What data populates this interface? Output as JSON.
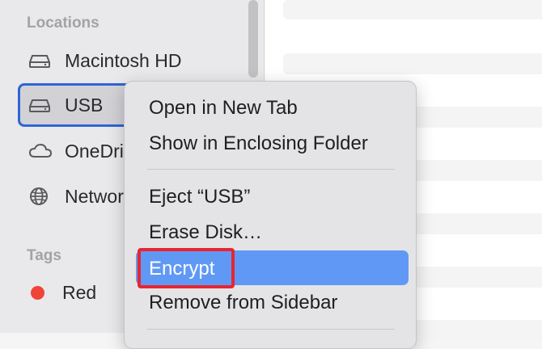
{
  "sidebar": {
    "locations_header": "Locations",
    "tags_header": "Tags",
    "items": [
      {
        "label": "Macintosh HD",
        "icon": "internal-drive-icon"
      },
      {
        "label": "USB",
        "icon": "external-drive-icon",
        "selected": true
      },
      {
        "label": "OneDrive",
        "icon": "cloud-icon"
      },
      {
        "label": "Network",
        "icon": "globe-icon"
      }
    ],
    "tags": [
      {
        "label": "Red",
        "color": "#f0443a"
      }
    ],
    "selected_border_color": "#2f64d6"
  },
  "context_menu": {
    "items": [
      {
        "label": "Open in New Tab"
      },
      {
        "label": "Show in Enclosing Folder"
      },
      {
        "label": "Eject “USB”"
      },
      {
        "label": "Erase Disk…"
      },
      {
        "label": "Encrypt",
        "highlighted": true
      },
      {
        "label": "Remove from Sidebar"
      }
    ],
    "highlight_color": "#5f99f5",
    "annotation_color": "#e8252f"
  }
}
